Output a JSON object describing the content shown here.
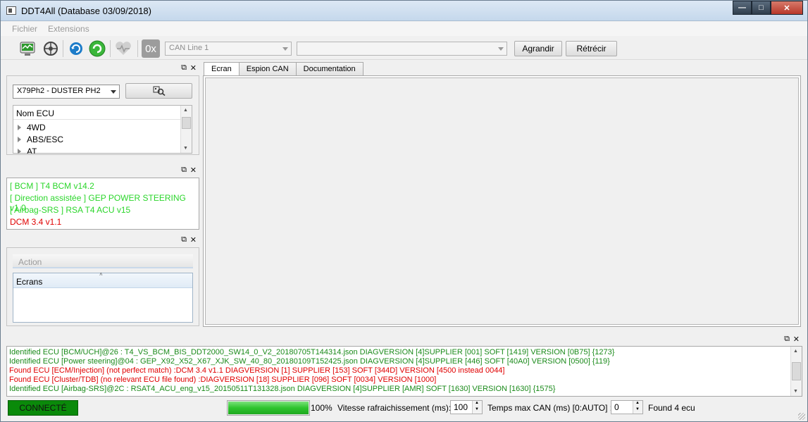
{
  "window": {
    "title": "DDT4All (Database 03/09/2018)"
  },
  "menu": {
    "items": [
      "Fichier",
      "Extensions"
    ]
  },
  "toolbar": {
    "hex_label": "0x",
    "can_line_value": "CAN Line 1",
    "second_combo_value": "",
    "agrandir_label": "Agrandir",
    "retrecir_label": "Rétrécir"
  },
  "vehicle": {
    "selected": "X79Ph2 - DUSTER PH2"
  },
  "ecu_tree": {
    "header": "Nom ECU",
    "items": [
      "4WD",
      "ABS/ESC",
      "AT"
    ]
  },
  "found_ecus": [
    {
      "text": "[ BCM ] T4 BCM v14.2",
      "status": "ok"
    },
    {
      "text": "[ Direction assistée ] GEP POWER STEERING v1.0",
      "status": "ok"
    },
    {
      "text": "[ Airbag-SRS ] RSA T4 ACU v15",
      "status": "ok"
    },
    {
      "text": "DCM 3.4 v1.1",
      "status": "error"
    }
  ],
  "action_panel": {
    "action_label": "Action",
    "screens_header": "Ecrans"
  },
  "tabs": [
    "Ecran",
    "Espion CAN",
    "Documentation"
  ],
  "log": [
    {
      "text": "Identified ECU [BCM/UCH]@26 : T4_VS_BCM_BIS_DDT2000_SW14_0_V2_20180705T144314.json DIAGVERSION [4]SUPPLIER [001] SOFT [1419] VERSION [0B75] {1273}",
      "level": "ok"
    },
    {
      "text": "Identified ECU [Power steering]@04 : GEP_X92_X52_X67_XJK_SW_40_80_20180109T152425.json DIAGVERSION [4]SUPPLIER [446] SOFT [40A0] VERSION [0500] {119}",
      "level": "ok"
    },
    {
      "text": "Found ECU [ECM/Injection] (not perfect match) :DCM 3.4 v1.1 DIAGVERSION [1] SUPPLIER [153] SOFT [344D] VERSION [4500 instead 0044]",
      "level": "error"
    },
    {
      "text": "Found ECU [Cluster/TDB] (no relevant ECU file found) :DIAGVERSION [18] SUPPLIER [096] SOFT [0034] VERSION [1000]",
      "level": "error"
    },
    {
      "text": "Identified ECU [Airbag-SRS]@2C : RSAT4_ACU_eng_v15_20150511T131328.json DIAGVERSION [4]SUPPLIER [AMR] SOFT [1630] VERSION [1630] {1575}",
      "level": "ok"
    }
  ],
  "statusbar": {
    "connection": "CONNECTÉ",
    "progress_percent": 100,
    "progress_label": "100%",
    "refresh_label": "Vitesse rafraichissement (ms):",
    "refresh_value": "100",
    "can_time_label": "Temps max CAN (ms) [0:AUTO] :",
    "can_time_value": "0",
    "found_label": "Found 4 ecu"
  },
  "colors": {
    "ok": "#2bd62b",
    "log_ok": "#1a8a1a",
    "error": "#e00000",
    "connected_bg": "#0a8a0a",
    "progress": "#2ec42e"
  }
}
